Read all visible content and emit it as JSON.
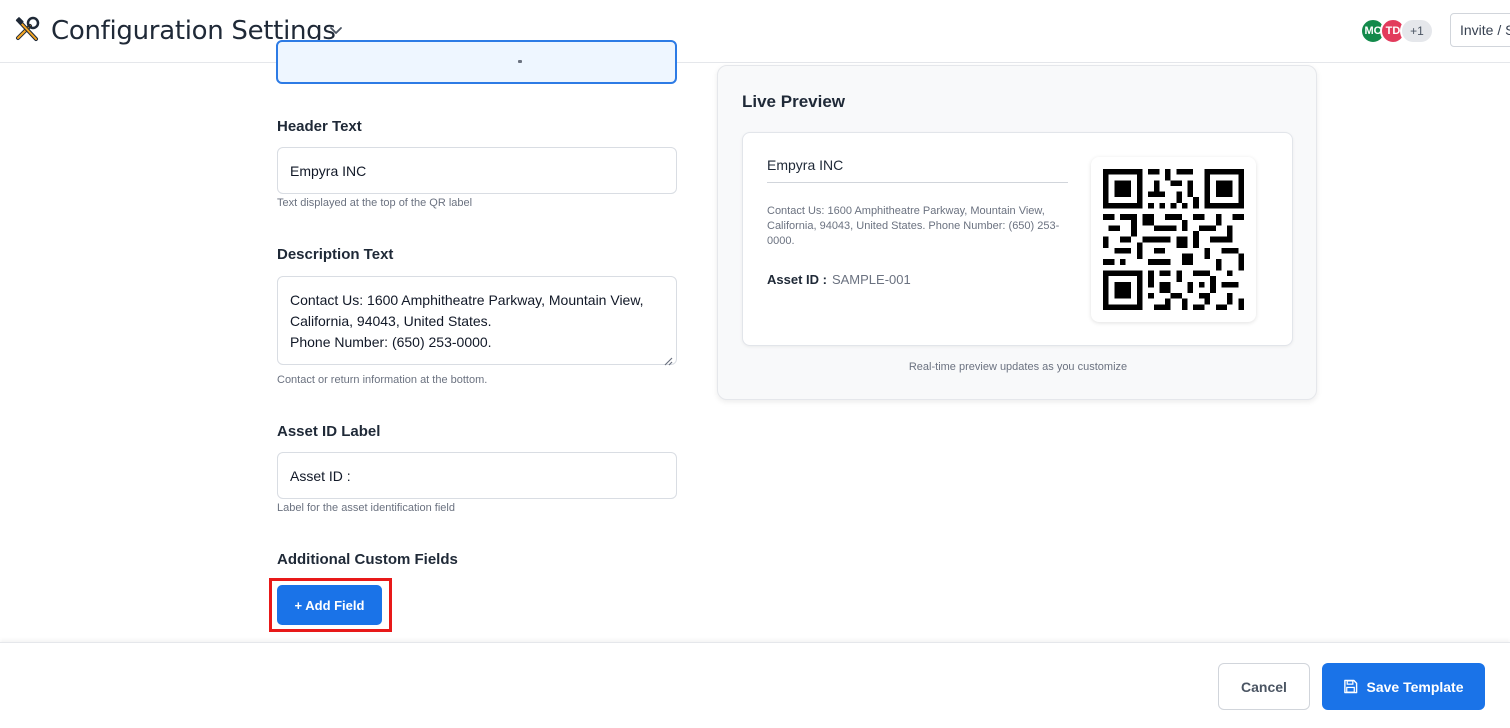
{
  "header": {
    "title": "Configuration Settings",
    "app_icon": "tools-icon",
    "chevron_icon": "chevron-down-icon",
    "collaborators": [
      {
        "initials": "MC",
        "color": "#138a4b"
      },
      {
        "initials": "TD",
        "color": "#e23b5c"
      }
    ],
    "more_collaborators": "+1",
    "invite_label": "Invite / Share"
  },
  "form": {
    "header_text": {
      "label": "Header Text",
      "value": "Empyra INC",
      "hint": "Text displayed at the top of the QR label"
    },
    "description_text": {
      "label": "Description Text",
      "lines": [
        "Contact Us: 1600 Amphitheatre Parkway, Mountain View,",
        "California, 94043, United States.",
        "Phone Number: (650) 253-0000."
      ],
      "hint": "Contact or return information at the bottom."
    },
    "asset_id_label": {
      "label": "Asset ID Label",
      "value": "Asset ID :",
      "hint": "Label for the asset identification field"
    },
    "custom_fields": {
      "label": "Additional Custom Fields",
      "add_button": "+ Add Field"
    }
  },
  "preview": {
    "title": "Live Preview",
    "header": "Empyra INC",
    "description": "Contact Us: 1600 Amphitheatre Parkway, Mountain View, California, 94043, United States. Phone Number: (650) 253-0000.",
    "asset_label": "Asset ID :",
    "asset_value": "SAMPLE-001",
    "qr_icon": "qr-code-icon",
    "caption": "Real-time preview updates as you customize"
  },
  "footer": {
    "cancel_label": "Cancel",
    "save_label": "Save Template",
    "save_icon": "floppy-disk-icon"
  },
  "colors": {
    "primary": "#1a73e8",
    "highlight": "#e81919",
    "active_border": "#2d7be5"
  }
}
